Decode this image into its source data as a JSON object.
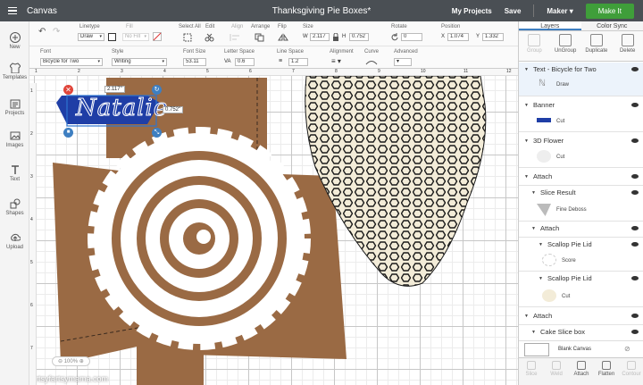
{
  "topbar": {
    "app": "Canvas",
    "title": "Thanksgiving Pie Boxes*",
    "my_projects": "My Projects",
    "save": "Save",
    "machine": "Maker",
    "make_it": "Make It"
  },
  "leftbar": {
    "items": [
      {
        "label": "New",
        "icon": "plus-icon"
      },
      {
        "label": "Templates",
        "icon": "shirt-icon"
      },
      {
        "label": "Projects",
        "icon": "folder-icon"
      },
      {
        "label": "Images",
        "icon": "image-icon"
      },
      {
        "label": "Text",
        "icon": "text-icon"
      },
      {
        "label": "Shapes",
        "icon": "shapes-icon"
      },
      {
        "label": "Upload",
        "icon": "upload-icon"
      }
    ]
  },
  "toolbar": {
    "linetype_label": "Linetype",
    "linetype_value": "Draw",
    "fill_label": "Fill",
    "fill_value": "No Fill",
    "select_all": "Select All",
    "edit": "Edit",
    "align": "Align",
    "arrange": "Arrange",
    "flip": "Flip",
    "size_label": "Size",
    "w_label": "W",
    "w_value": "2.117",
    "h_label": "H",
    "h_value": "0.752",
    "rotate_label": "Rotate",
    "rotate_value": "0",
    "position_label": "Position",
    "x_label": "X",
    "x_value": "1.074",
    "y_label": "Y",
    "y_value": "1.332"
  },
  "textbar": {
    "font_label": "Font",
    "font_value": "Bicycle for Two",
    "style_label": "Style",
    "style_value": "Writing",
    "font_size_label": "Font Size",
    "font_size_value": "53.11",
    "letter_space_label": "Letter Space",
    "letter_space_prefix": "VA",
    "letter_space_value": "0.6",
    "line_space_label": "Line Space",
    "line_space_value": "1.2",
    "alignment_label": "Alignment",
    "curve_label": "Curve",
    "advanced_label": "Advanced"
  },
  "canvas": {
    "text_object": "Natalie",
    "width_tag": "2.117\"",
    "height_tag": "0.752\"",
    "zoom": "100%",
    "watermark": "artsyfartsymama.com",
    "ruler_marks": [
      "1",
      "2",
      "3",
      "4",
      "5",
      "6",
      "7",
      "8",
      "9",
      "10",
      "11",
      "12"
    ],
    "ruler_v_marks": [
      "1",
      "2",
      "3",
      "4",
      "5",
      "6",
      "7"
    ],
    "colors": {
      "cardstock": "#9a6a44",
      "banner": "#1f3ea6",
      "pattern_bg": "#f3ecd8"
    }
  },
  "panel": {
    "tabs": [
      "Layers",
      "Color Sync"
    ],
    "tools": [
      "Group",
      "UnGroup",
      "Duplicate",
      "Delete"
    ],
    "layers": [
      {
        "title": "Text - Bicycle for Two",
        "op": "Draw"
      },
      {
        "title": "Banner",
        "op": "Cut"
      },
      {
        "title": "3D Flower",
        "op": "Cut"
      },
      {
        "title": "Attach"
      },
      {
        "title": "Slice Result",
        "op": "Fine Deboss"
      },
      {
        "title": "Attach"
      },
      {
        "title": "Scallop Pie Lid",
        "op": "Score"
      },
      {
        "title": "Scallop Pie Lid",
        "op": "Cut"
      },
      {
        "title": "Attach"
      },
      {
        "title": "Cake Slice box"
      }
    ],
    "blank_canvas": "Blank Canvas",
    "bottom_tools": [
      "Slice",
      "Weld",
      "Attach",
      "Flatten",
      "Contour"
    ]
  }
}
